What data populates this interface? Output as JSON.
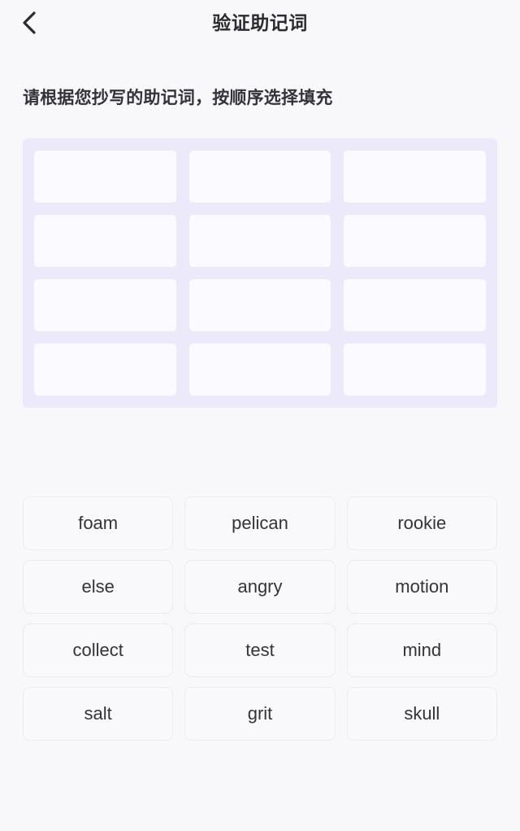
{
  "header": {
    "title": "验证助记词",
    "back_icon": "chevron-left-icon"
  },
  "instruction": "请根据您抄写的助记词，按顺序选择填充",
  "slot_grid": {
    "rows": 4,
    "columns": 3,
    "slots": [
      "",
      "",
      "",
      "",
      "",
      "",
      "",
      "",
      "",
      "",
      "",
      ""
    ]
  },
  "word_bank": {
    "words": [
      "foam",
      "pelican",
      "rookie",
      "else",
      "angry",
      "motion",
      "collect",
      "test",
      "mind",
      "salt",
      "grit",
      "skull"
    ]
  },
  "colors": {
    "page_background": "#f8f7fa",
    "grid_background": "#eceafa",
    "slot_background": "#fafaff",
    "word_button_background": "#f9f9fb",
    "word_button_border": "#eceaee",
    "text_primary": "#2b2b2f"
  }
}
